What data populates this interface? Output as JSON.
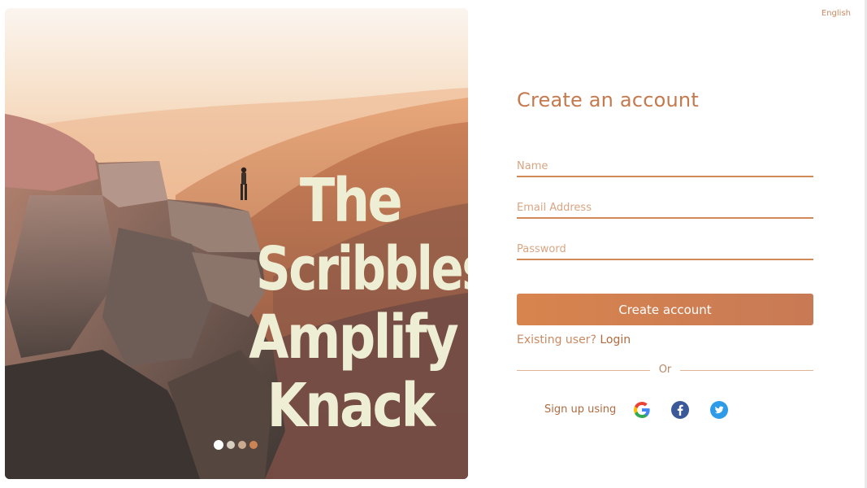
{
  "language": "English",
  "hero": {
    "headline": [
      "The",
      "Scribbles",
      "Amplify",
      "Knack"
    ],
    "slide_count": 4,
    "active_slide": 1
  },
  "form": {
    "title": "Create an account",
    "name_placeholder": "Name",
    "email_placeholder": "Email Address",
    "password_placeholder": "Password",
    "submit_label": "Create account",
    "existing_prompt": "Existing user?",
    "login_link": "Login",
    "divider_text": "Or",
    "social_label": "Sign up using"
  },
  "social_icons": [
    "google-icon",
    "facebook-icon",
    "twitter-icon"
  ],
  "colors": {
    "accent": "#c47a4e",
    "button_start": "#d8844e",
    "button_end": "#c87a55",
    "headline": "#eeeed4",
    "facebook": "#3b5998",
    "twitter": "#1da1f2"
  }
}
